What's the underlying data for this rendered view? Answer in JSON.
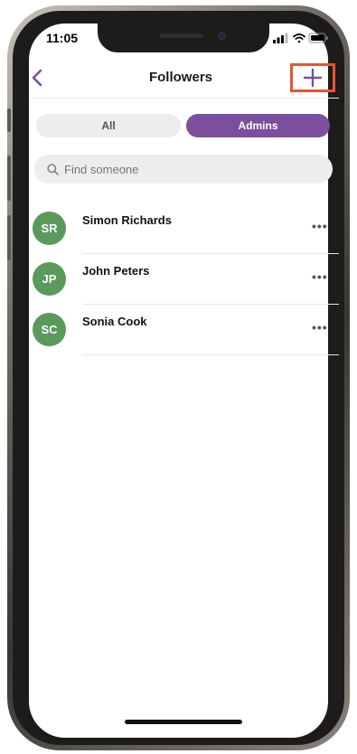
{
  "status_bar": {
    "time": "11:05"
  },
  "nav": {
    "title": "Followers"
  },
  "tabs": [
    {
      "label": "All",
      "active": false
    },
    {
      "label": "Admins",
      "active": true
    }
  ],
  "search": {
    "placeholder": "Find someone"
  },
  "followers": [
    {
      "initials": "SR",
      "name": "Simon Richards"
    },
    {
      "initials": "JP",
      "name": "John Peters"
    },
    {
      "initials": "SC",
      "name": "Sonia Cook"
    }
  ],
  "colors": {
    "accent": "#7c4f9e",
    "avatar": "#5a9a5d",
    "highlight_box": "#e8552d"
  },
  "icons": {
    "back": "chevron-left-icon",
    "add": "plus-icon",
    "search": "magnifier-icon",
    "more": "ellipsis-icon"
  }
}
